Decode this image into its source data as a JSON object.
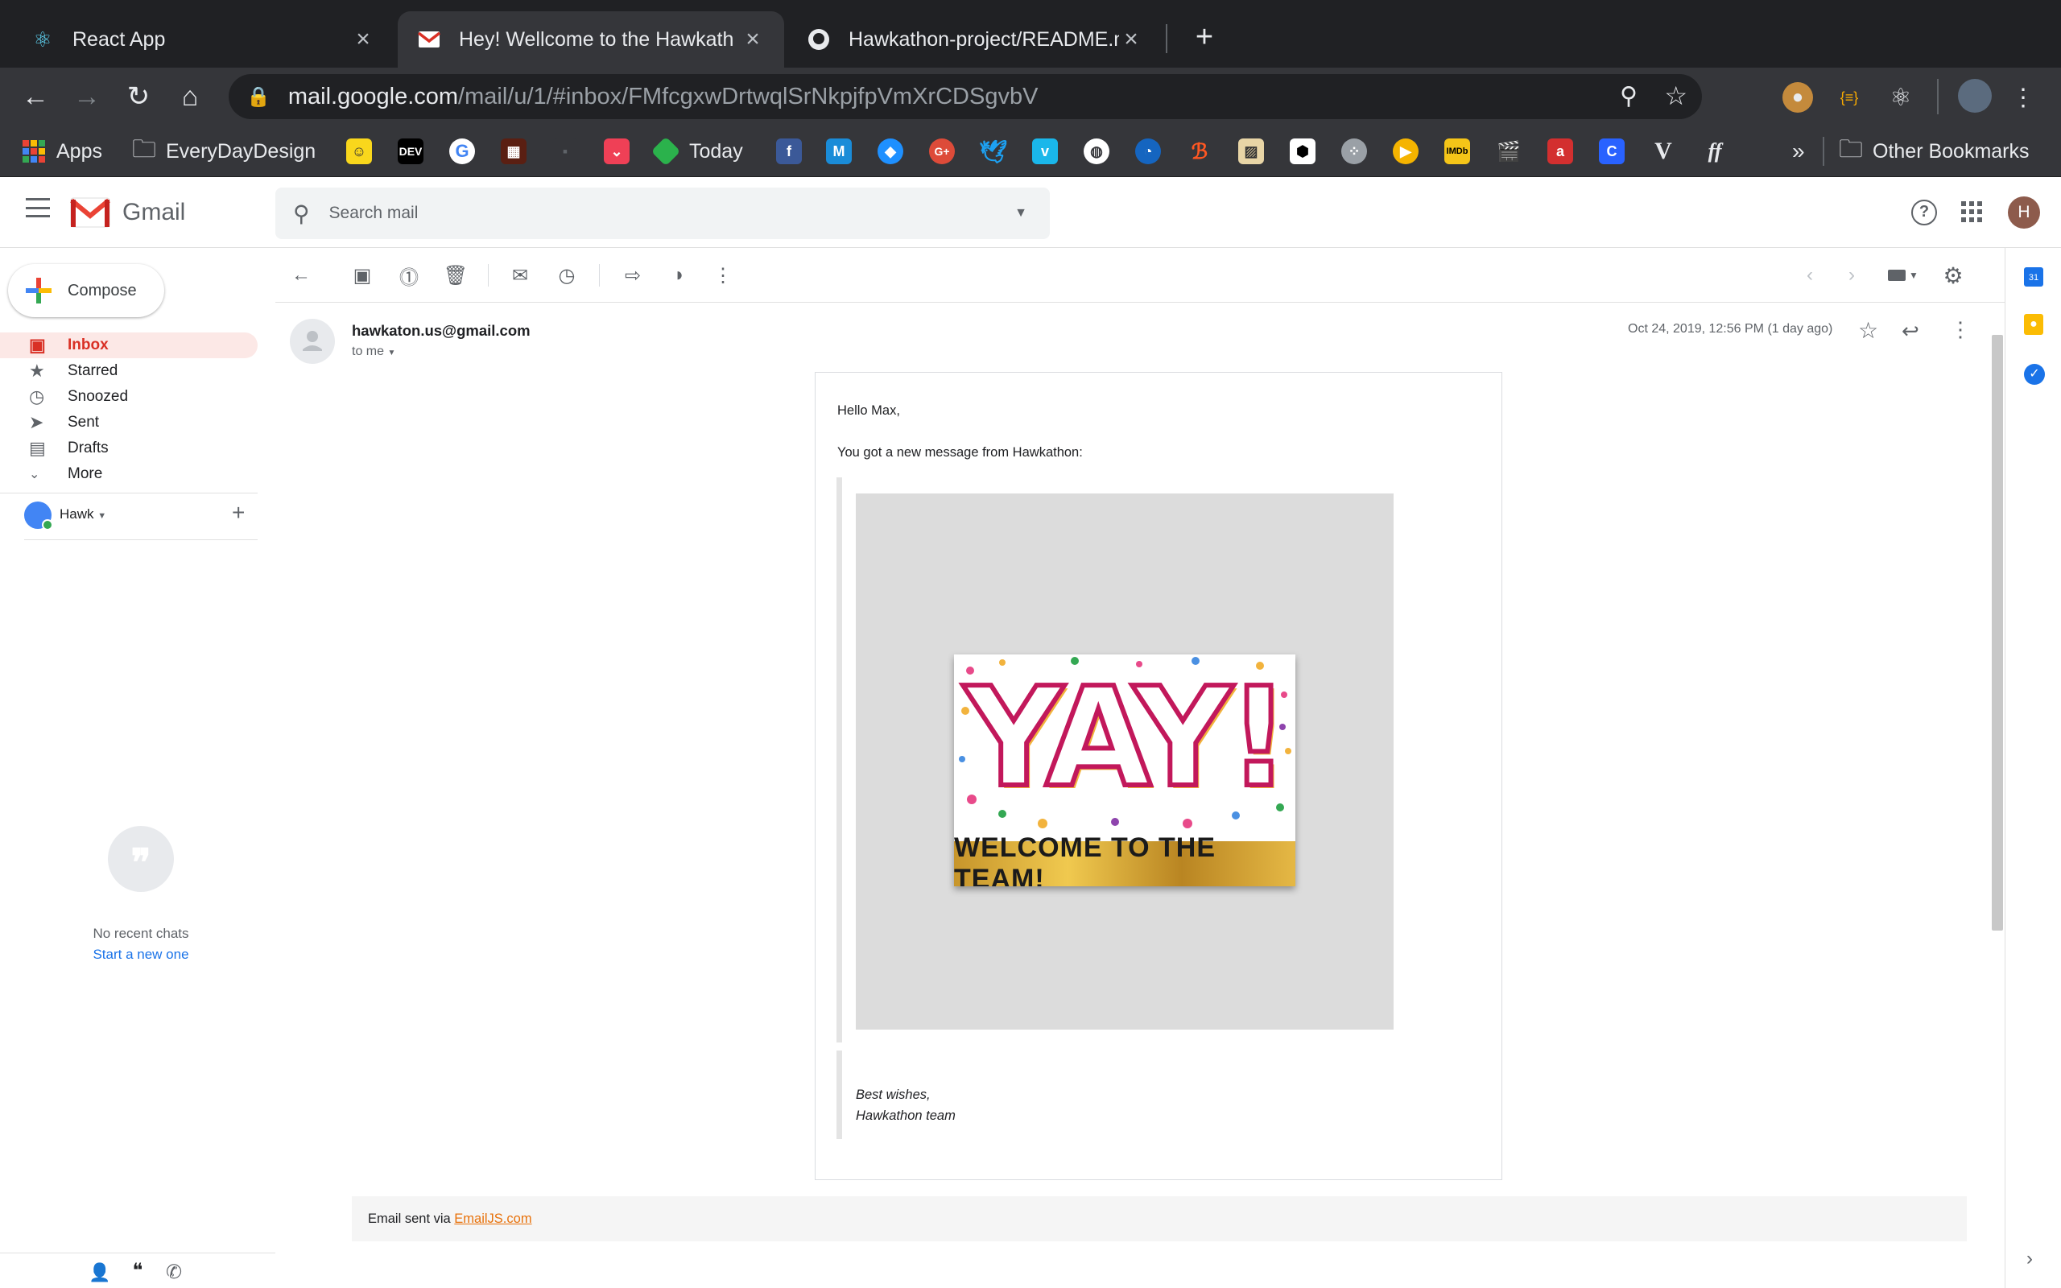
{
  "browser": {
    "tabs": [
      {
        "title": "React App",
        "favicon": "react-icon"
      },
      {
        "title": "Hey! Wellcome to the Hawkath",
        "favicon": "gmail-icon"
      },
      {
        "title": "Hawkathon-project/README.m",
        "favicon": "github-icon"
      }
    ],
    "url_host": "mail.google.com",
    "url_path": "/mail/u/1/#inbox/FMfcgxwDrtwqlSrNkpjfpVmXrCDSgvbV",
    "bookmarks": {
      "apps": "Apps",
      "everydaydesign": "EveryDayDesign",
      "today": "Today",
      "overflow": "»",
      "other": "Other Bookmarks"
    }
  },
  "gmail": {
    "logo_text": "Gmail",
    "search_placeholder": "Search mail",
    "avatar_letter": "H",
    "compose": "Compose",
    "nav": [
      {
        "label": "Inbox",
        "icon": "inbox-icon"
      },
      {
        "label": "Starred",
        "icon": "star-icon"
      },
      {
        "label": "Snoozed",
        "icon": "clock-icon"
      },
      {
        "label": "Sent",
        "icon": "send-icon"
      },
      {
        "label": "Drafts",
        "icon": "draft-icon"
      },
      {
        "label": "More",
        "icon": "chevron-down-icon"
      }
    ],
    "hangouts_user": "Hawk",
    "no_chats": "No recent chats",
    "start_new": "Start a new one"
  },
  "message": {
    "sender": "hawkaton.us@gmail.com",
    "to": "to me",
    "date": "Oct 24, 2019, 12:56 PM (1 day ago)",
    "greeting": "Hello Max,",
    "intro": "You got a new message from Hawkathon:",
    "image_big": "YAY!",
    "image_banner": "WELCOME TO THE TEAM!",
    "sign1": "Best wishes,",
    "sign2": "Hawkathon team",
    "footer_prefix": "Email sent via ",
    "footer_link": "EmailJS.com"
  },
  "colors": {
    "chrome_dark": "#202124",
    "chrome_toolbar": "#35363a",
    "gmail_red": "#d93025",
    "link_blue": "#1a73e8",
    "emailjs_orange": "#e8710a"
  }
}
